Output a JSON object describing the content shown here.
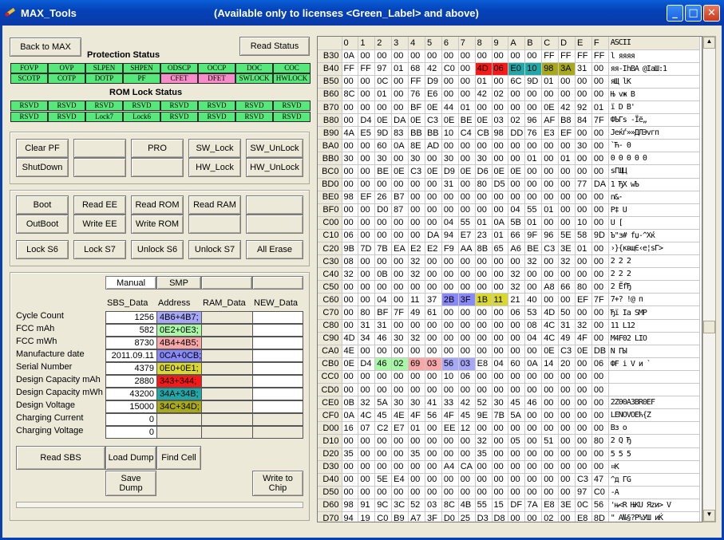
{
  "window": {
    "title": "MAX_Tools",
    "subtitle": "(Available only to licenses <Green_Label> and above)"
  },
  "colors": {
    "green": "#56e87a",
    "pink": "#f88cc8",
    "purple": "#a8a8f8",
    "yellow": "#d8d830",
    "red": "#f81818",
    "teal": "#20a8a8",
    "olive": "#a8a818",
    "lightgreen": "#a8f8a8",
    "lightred": "#f8a8a8"
  },
  "top": {
    "back": "Back to MAX",
    "read_status": "Read Status"
  },
  "protection": {
    "title": "Protection Status",
    "row1": [
      "FOVP",
      "OVP",
      "SLPEN",
      "SHPEN",
      "ODSCP",
      "OCCP",
      "DOC",
      "COC"
    ],
    "row2": [
      "SCOTP",
      "COTP",
      "DOTP",
      "PF",
      "CFET",
      "DFET",
      "SWLOCK",
      "HWLOCK"
    ]
  },
  "romlock": {
    "title": "ROM Lock Status",
    "row1": [
      "RSVD",
      "RSVD",
      "RSVD",
      "RSVD",
      "RSVD",
      "RSVD",
      "RSVD",
      "RSVD"
    ],
    "row2": [
      "RSVD",
      "RSVD",
      "Lock7",
      "Lock6",
      "RSVD",
      "RSVD",
      "RSVD",
      "RSVD"
    ]
  },
  "panel1": {
    "clear_pf": "Clear PF",
    "shutdown": "ShutDown",
    "pro": "PRO",
    "sw_lock": "SW_Lock",
    "sw_unlock": "SW_UnLock",
    "hw_lock": "HW_Lock",
    "hw_unlock": "HW_UnLock"
  },
  "panel2": {
    "boot": "Boot",
    "outboot": "OutBoot",
    "read_ee": "Read EE",
    "write_ee": "Write EE",
    "read_rom": "Read ROM",
    "write_rom": "Write ROM",
    "read_ram": "Read RAM",
    "lock_s6": "Lock S6",
    "lock_s7": "Lock S7",
    "unlock_s6": "Unlock S6",
    "unlock_s7": "Unlock S7",
    "all_erase": "All Erase"
  },
  "tabs": {
    "manual": "Manual",
    "smp": "SMP"
  },
  "sbs": {
    "col_headers": [
      "SBS_Data",
      "Address",
      "RAM_Data",
      "NEW_Data"
    ],
    "rows": [
      {
        "label": "Cycle Count",
        "value": "1256",
        "address": "4B6+4B7;",
        "color": "#a8a8f8"
      },
      {
        "label": "FCC     mAh",
        "value": "582",
        "address": "0E2+0E3;",
        "color": "#a8f8a8"
      },
      {
        "label": "FCC     mWh",
        "value": "8730",
        "address": "4B4+4B5;",
        "color": "#f8a8a8"
      },
      {
        "label": "Manufacture date",
        "value": "2011.09.11",
        "address": "0CA+0CB;",
        "color": "#8888f8"
      },
      {
        "label": "Serial Number",
        "value": "4379",
        "address": "0E0+0E1;",
        "color": "#d8d830"
      },
      {
        "label": "Design Capacity mAh",
        "value": "2880",
        "address": "343+344;",
        "color": "#f81818"
      },
      {
        "label": "Design Capacity mWh",
        "value": "43200",
        "address": "34A+34B;",
        "color": "#20a8a8"
      },
      {
        "label": "Design Voltage",
        "value": "15000",
        "address": "34C+34D;",
        "color": "#a8a818"
      },
      {
        "label": "Charging Current",
        "value": "0",
        "address": "",
        "color": ""
      },
      {
        "label": "Charging Voltage",
        "value": "0",
        "address": "",
        "color": ""
      }
    ]
  },
  "bottom": {
    "read_sbs": "Read   SBS",
    "load_dump": "Load Dump",
    "find_cell": "Find Cell",
    "save_dump": "Save\nDump",
    "write_chip": "Write to\nChip"
  },
  "hex": {
    "cols": [
      "0",
      "1",
      "2",
      "3",
      "4",
      "5",
      "6",
      "7",
      "8",
      "9",
      "A",
      "B",
      "C",
      "D",
      "E",
      "F"
    ],
    "ascii_header": "ASCII",
    "rows": [
      [
        "B30",
        "0A 00 00 00 00 00 00 00 00 00 00 00 FF FF FF FF",
        "l          яяяя"
      ],
      [
        "B40",
        "FF FF 97 01 68 42 C0 00 4D 06 E0 10 98 3A 31 00",
        "яя-IhBA  @IaШ:1"
      ],
      [
        "B50",
        "00 00 0C 00 FF D9 00 00 01 00 6C 9D 01 00 00 00",
        "  яЩ    lK"
      ],
      [
        "B60",
        "8C 00 01 00 76 E6 00 00 42 02 00 00 00 00 00 00",
        "Њ  vж  B"
      ],
      [
        "B70",
        "00 00 00 00 BF 0E 44 01 00 00 00 00 0E 42 92 01",
        "   ї D     B'"
      ],
      [
        "B80",
        "00 D4 0E DA 0E C3 0E BE 0E 03 02 96 AF B8 84 7F",
        "ФЪГѕ  -Їё„"
      ],
      [
        "B90",
        "4A E5 9D 83 BB BB 10 C4 CB 98 DD 76 E3 EF 00 00",
        "Jeќѓ»»ДЛЭvгп"
      ],
      [
        "BA0",
        "00 00 60 0A 8E AD 00 00 00 00 00 00 00 00 30 00",
        "  `Ћ-        0"
      ],
      [
        "BB0",
        "30 00 30 00 30 00 30 00 30 00 00 01 00 01 00 00",
        "0 0 0 0 0"
      ],
      [
        "BC0",
        "00 00 BE 0E C3 0E D9 0E D6 0E 0E 00 00 00 00 00",
        "  ѕГЩЦ"
      ],
      [
        "BD0",
        "00 00 00 00 00 00 31 00 80 D5 00 00 00 00 77 DA",
        "      1 ЂХ    wЪ"
      ],
      [
        "BE0",
        "98 EF 26 B7 00 00 00 00 00 00 00 00 00 00 00 00",
        "п&·"
      ],
      [
        "BF0",
        "00 00 D0 87 00 00 00 00 00 00 04 55 01 00 00 00",
        "  Р‡      U"
      ],
      [
        "C00",
        "00 00 00 00 00 00 04 55 01 0A 5B 01 00 00 10 00",
        "      U [ "
      ],
      [
        "C10",
        "06 00 00 00 00 DA 94 E7 23 01 66 9F 96 5E 58 9D",
        "     Ъ\"з# fџ-^Xќ"
      ],
      [
        "C20",
        "9B 7D 7B EA E2 E2 F9 AA 8B 65 A6 BE C3 3E 01 00",
        "›}{квщЄ‹e¦ѕГ>"
      ],
      [
        "C30",
        "08 00 00 00 32 00 00 00 00 00 00 32 00 32 00 00",
        "    2      2 2"
      ],
      [
        "C40",
        "32 00 0B 00 32 00 00 00 00 00 32 00 00 00 00 00",
        "2   2     2"
      ],
      [
        "C50",
        "00 00 00 00 00 00 00 00 00 00 32 00 A8 66 80 00",
        "          2 ЁfЂ"
      ],
      [
        "C60",
        "00 00 04 00 11 37 2B 3F 1B 11 21 40 00 00 EF 7F",
        "    7+? !@  п"
      ],
      [
        "C70",
        "00 80 BF 7F 49 61 00 00 00 00 06 53 4D 50 00 00",
        " Ђї Ia     SMP"
      ],
      [
        "C80",
        "00 31 31 00 00 00 00 00 00 00 00 08 4C 31 32 00",
        " 11         L12"
      ],
      [
        "C90",
        "4D 34 46 30 32 00 00 00 00 00 00 04 4C 49 4F 00",
        "M4F02       LIO"
      ],
      [
        "CA0",
        "4E 00 00 00 00 00 00 00 00 00 00 00 0E C3 0E DB",
        "N           ГЫ"
      ],
      [
        "CB0",
        "0E D4 46 02 69 03 56 03 E8 04 60 0A 14 20 00 06",
        " ФF i V и `  "
      ],
      [
        "CC0",
        "00 00 00 00 00 00 10 06 00 00 00 00 00 00 00 00",
        "      "
      ],
      [
        "CD0",
        "00 00 00 00 00 00 00 00 00 00 00 00 00 00 00 00",
        ""
      ],
      [
        "CE0",
        "0B 32 5A 30 30 41 33 42 52 30 45 46 00 00 00 00",
        "2Z00A3BR0EF"
      ],
      [
        "CF0",
        "0A 4C 45 4E 4F 56 4F 45 9E 7B 5A 00 00 00 00 00",
        "LENOVOEћ{Z"
      ],
      [
        "D00",
        "16 07 C2 E7 01 00 EE 12 00 00 00 00 00 00 00 00",
        "  Вз  о"
      ],
      [
        "D10",
        "00 00 00 00 00 00 00 00 32 00 05 00 51 00 00 80",
        "        2   Q  Ђ"
      ],
      [
        "D20",
        "35 00 00 00 35 00 00 00 35 00 00 00 00 00 00 00",
        "5   5   5"
      ],
      [
        "D30",
        "00 00 00 00 00 00 A4 CA 00 00 00 00 00 00 00 00",
        "      ¤К"
      ],
      [
        "D40",
        "00 00 5E E4 00 00 00 00 00 00 00 00 00 00 C3 47",
        "  ^д          ГG"
      ],
      [
        "D50",
        "00 00 00 00 00 00 00 00 00 00 00 00 00 00 97 C0",
        "              -А"
      ],
      [
        "D60",
        "98 91 9C 3C 52 03 8C 4B 55 15 DF 7A E8 3E 0C 56",
        "'њ<R ЊKU Яzи> V"
      ],
      [
        "D70",
        "94 19 C0 B9 A7 3F D0 25 D3 D8 00 00 02 00 E8 8D",
        "\" А№§?Р%УШ   иЌ"
      ]
    ]
  }
}
